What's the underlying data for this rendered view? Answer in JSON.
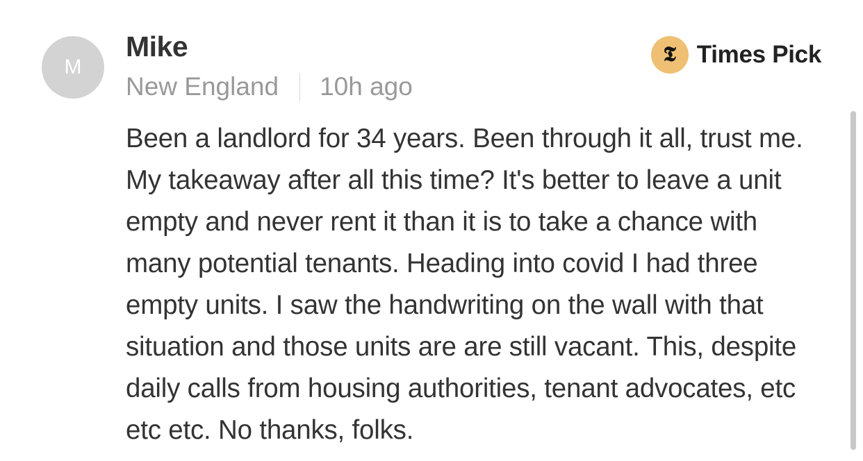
{
  "comment": {
    "avatar_initial": "M",
    "author": "Mike",
    "location": "New England",
    "timestamp": "10h ago",
    "badge_label": "Times Pick",
    "badge_logo": "𝕿",
    "body": "Been a landlord for 34 years. Been through it all, trust me. My takeaway after all this time? It's better to leave a unit empty and never rent it than it is to take a chance with many potential tenants. Heading into covid I had three empty units. I saw the handwriting on the wall with that situation and those units are are still vacant. This, despite daily calls from housing authorities, tenant advocates, etc etc etc. No thanks, folks."
  },
  "colors": {
    "avatar_bg": "#d3d3d3",
    "badge_bg": "#efc074",
    "meta_text": "#999999",
    "body_text": "#333333"
  },
  "icons": {
    "badge": "nyt-logo-icon"
  }
}
